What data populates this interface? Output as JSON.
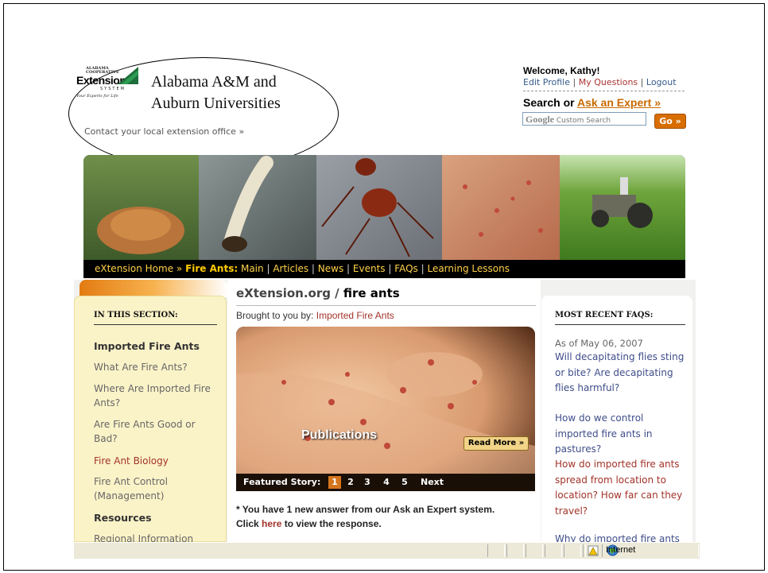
{
  "header": {
    "logo_text": [
      "ALABAMA",
      "COOPERATIVE",
      "Extension",
      "SYSTEM",
      "Your Experts for Life"
    ],
    "university_line1": "Alabama A&M and",
    "university_line2": "Auburn Universities",
    "contact_link": "Contact your local extension office »"
  },
  "user": {
    "welcome": "Welcome, Kathy!",
    "edit_profile": "Edit Profile",
    "my_questions": "My Questions",
    "logout": "Logout",
    "sep": "|"
  },
  "search": {
    "label_prefix": "Search or ",
    "ask_expert": "Ask an Expert »",
    "placeholder_brand": "Google",
    "placeholder_text": "Custom Search",
    "go_label": "Go »"
  },
  "nav": {
    "home": "eXtension Home »",
    "section": "Fire Ants:",
    "items": [
      "Main",
      "Articles",
      "News",
      "Events",
      "FAQs",
      "Learning Lessons"
    ]
  },
  "left": {
    "heading": "IN THIS SECTION:",
    "items": [
      {
        "label": "Imported Fire Ants",
        "style": "bold"
      },
      {
        "label": "What Are Fire Ants?",
        "style": "normal"
      },
      {
        "label": "Where Are Imported Fire Ants?",
        "style": "normal"
      },
      {
        "label": "Are Fire Ants Good or Bad?",
        "style": "normal"
      },
      {
        "label": "Fire Ant Biology",
        "style": "red"
      },
      {
        "label": "Fire Ant Control (Management)",
        "style": "normal"
      },
      {
        "label": "Resources",
        "style": "bold"
      },
      {
        "label": "Regional Information",
        "style": "normal"
      }
    ]
  },
  "center": {
    "title_prefix": "eXtension.org / ",
    "title_section": "fire ants",
    "brought_prefix": "Brought to you by: ",
    "brought_link": "Imported Fire Ants",
    "feature_caption": "Publications",
    "read_more": "Read More »",
    "featured_label": "Featured Story:",
    "pages": [
      "1",
      "2",
      "3",
      "4",
      "5"
    ],
    "next": "Next",
    "notice_line1": "* You have 1 new answer from our Ask an Expert system.",
    "notice_click": "Click ",
    "notice_here": "here",
    "notice_rest": " to view the response."
  },
  "right": {
    "heading": "MOST RECENT FAQS:",
    "as_of": "As of May 06, 2007",
    "faqs": [
      "Will decapitating flies sting or bite? Are decapitating flies harmful?",
      "How do we control imported fire ants in pastures?",
      "How do imported fire ants spread from location to location? How far can they travel?",
      "Why do imported fire ants"
    ]
  },
  "statusbar": {
    "zone": "Internet"
  },
  "colors": {
    "accent_orange": "#d86e00",
    "link_red": "#a3332a",
    "link_blue": "#3f4d8a",
    "nav_yellow": "#ffcc00"
  }
}
